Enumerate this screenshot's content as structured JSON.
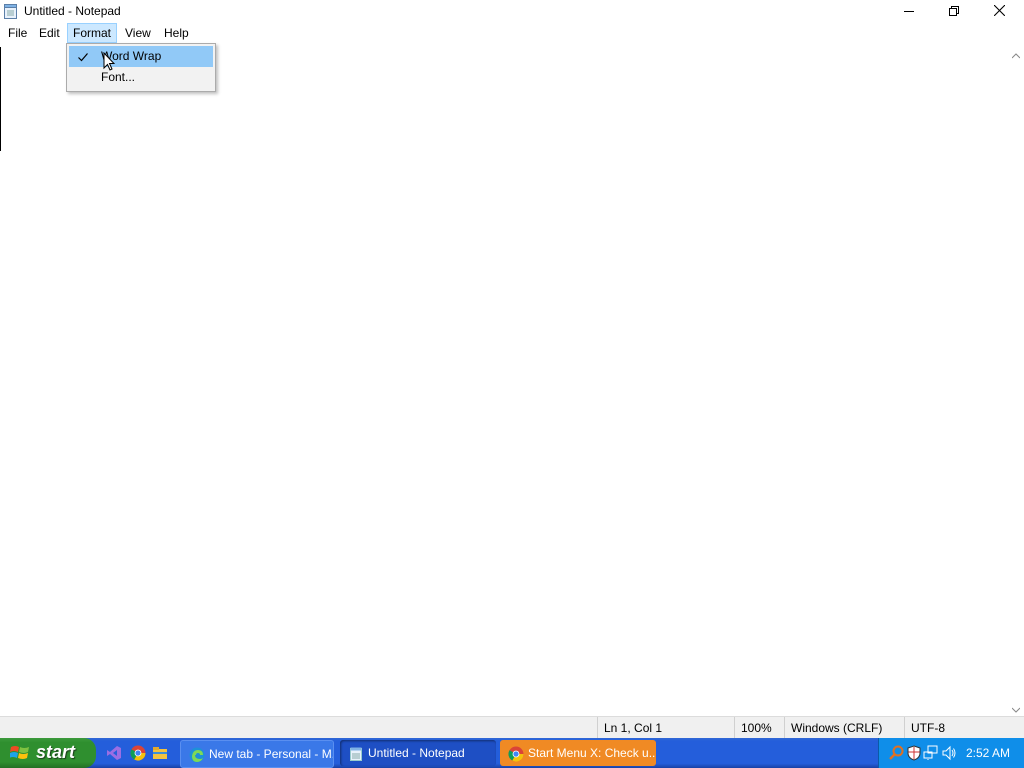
{
  "window": {
    "title": "Untitled - Notepad",
    "icons": {
      "app": "notepad-icon",
      "minimize": "minimize-icon",
      "restore": "restore-icon",
      "close": "close-icon"
    }
  },
  "menubar": {
    "items": [
      {
        "label": "File"
      },
      {
        "label": "Edit"
      },
      {
        "label": "Format"
      },
      {
        "label": "View"
      },
      {
        "label": "Help"
      }
    ],
    "active": "Format"
  },
  "format_menu": {
    "items": [
      {
        "label": "Word Wrap",
        "checked": true
      },
      {
        "label": "Font...",
        "checked": false
      }
    ]
  },
  "editor": {
    "text": ""
  },
  "statusbar": {
    "position": "Ln 1, Col 1",
    "zoom": "100%",
    "line_ending": "Windows (CRLF)",
    "encoding": "UTF-8"
  },
  "taskbar": {
    "start_label": "start",
    "quick_launch": [
      "visual-studio-icon",
      "chrome-icon",
      "file-explorer-icon"
    ],
    "tasks": [
      {
        "label": "New tab - Personal - M...",
        "icon": "edge-icon"
      },
      {
        "label": "Untitled - Notepad",
        "icon": "notepad-icon"
      },
      {
        "label": "Start Menu X: Check u...",
        "icon": "chrome-icon"
      }
    ],
    "tray_icons": [
      "search-icon",
      "shield-icon",
      "network-icon",
      "volume-icon"
    ],
    "clock": "2:52 AM"
  },
  "colors": {
    "menu_active_bg": "#cce8ff",
    "menu_hover_bg": "#91c9f7",
    "taskbar_blue": "#245edb",
    "start_green": "#2f8f2f",
    "task_active": "#1e4fc4",
    "task_orange": "#f08a24",
    "tray_blue": "#0f8ee9"
  }
}
